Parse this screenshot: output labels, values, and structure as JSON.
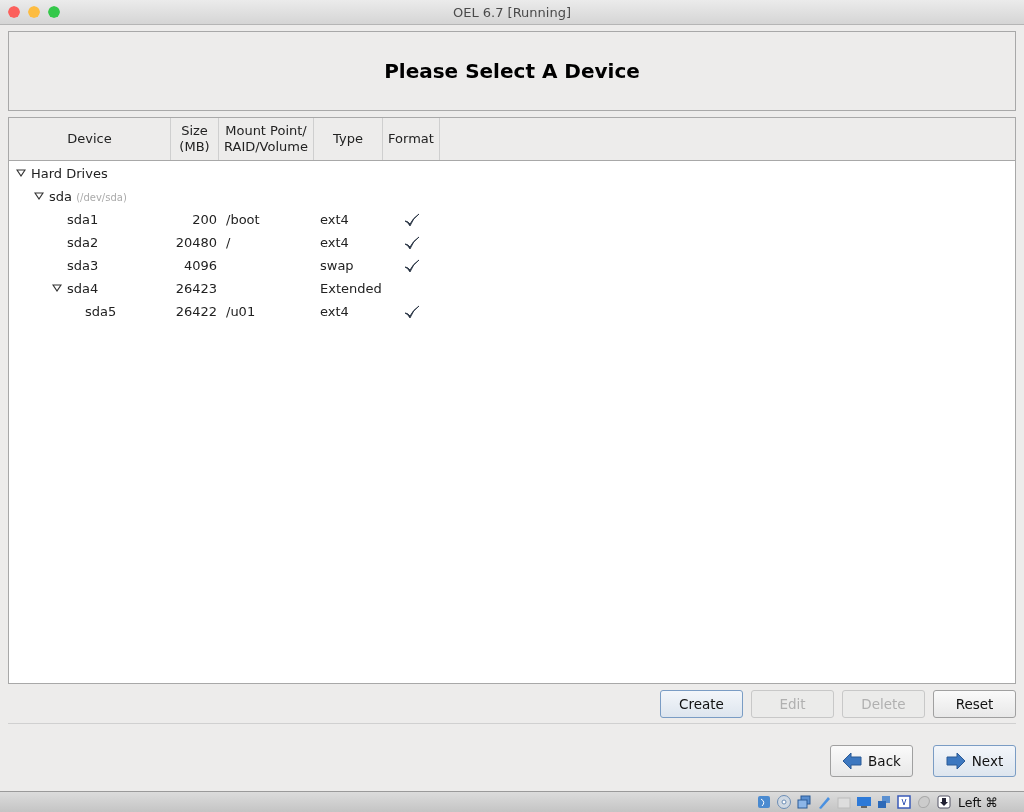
{
  "window": {
    "title": "OEL 6.7 [Running]"
  },
  "heading": "Please Select A Device",
  "table": {
    "columns": [
      "Device",
      "Size\n(MB)",
      "Mount Point/\nRAID/Volume",
      "Type",
      "Format"
    ],
    "rows": [
      {
        "device": "Hard Drives",
        "expanded": true,
        "children": [
          {
            "device": "sda",
            "hint": "(/dev/sda)",
            "expanded": true,
            "children": [
              {
                "device": "sda1",
                "size": "200",
                "mount": "/boot",
                "type": "ext4",
                "format": true
              },
              {
                "device": "sda2",
                "size": "20480",
                "mount": "/",
                "type": "ext4",
                "format": true
              },
              {
                "device": "sda3",
                "size": "4096",
                "type": "swap",
                "format": true
              },
              {
                "device": "sda4",
                "size": "26423",
                "type": "Extended",
                "format": false,
                "expanded": true,
                "children": [
                  {
                    "device": "sda5",
                    "size": "26422",
                    "mount": "/u01",
                    "type": "ext4",
                    "format": true
                  }
                ]
              }
            ]
          }
        ]
      }
    ]
  },
  "actions": [
    {
      "label": "Create",
      "disabled": false,
      "focused": true
    },
    {
      "label": "Edit",
      "disabled": true,
      "focused": false
    },
    {
      "label": "Delete",
      "disabled": true,
      "focused": false
    },
    {
      "label": "Reset",
      "disabled": false,
      "focused": false
    }
  ],
  "navigation": [
    {
      "label": "Back",
      "kind": "back",
      "focused": false
    },
    {
      "label": "Next",
      "kind": "next",
      "focused": true
    }
  ],
  "status_bar": {
    "host_key": "Left ⌘"
  }
}
